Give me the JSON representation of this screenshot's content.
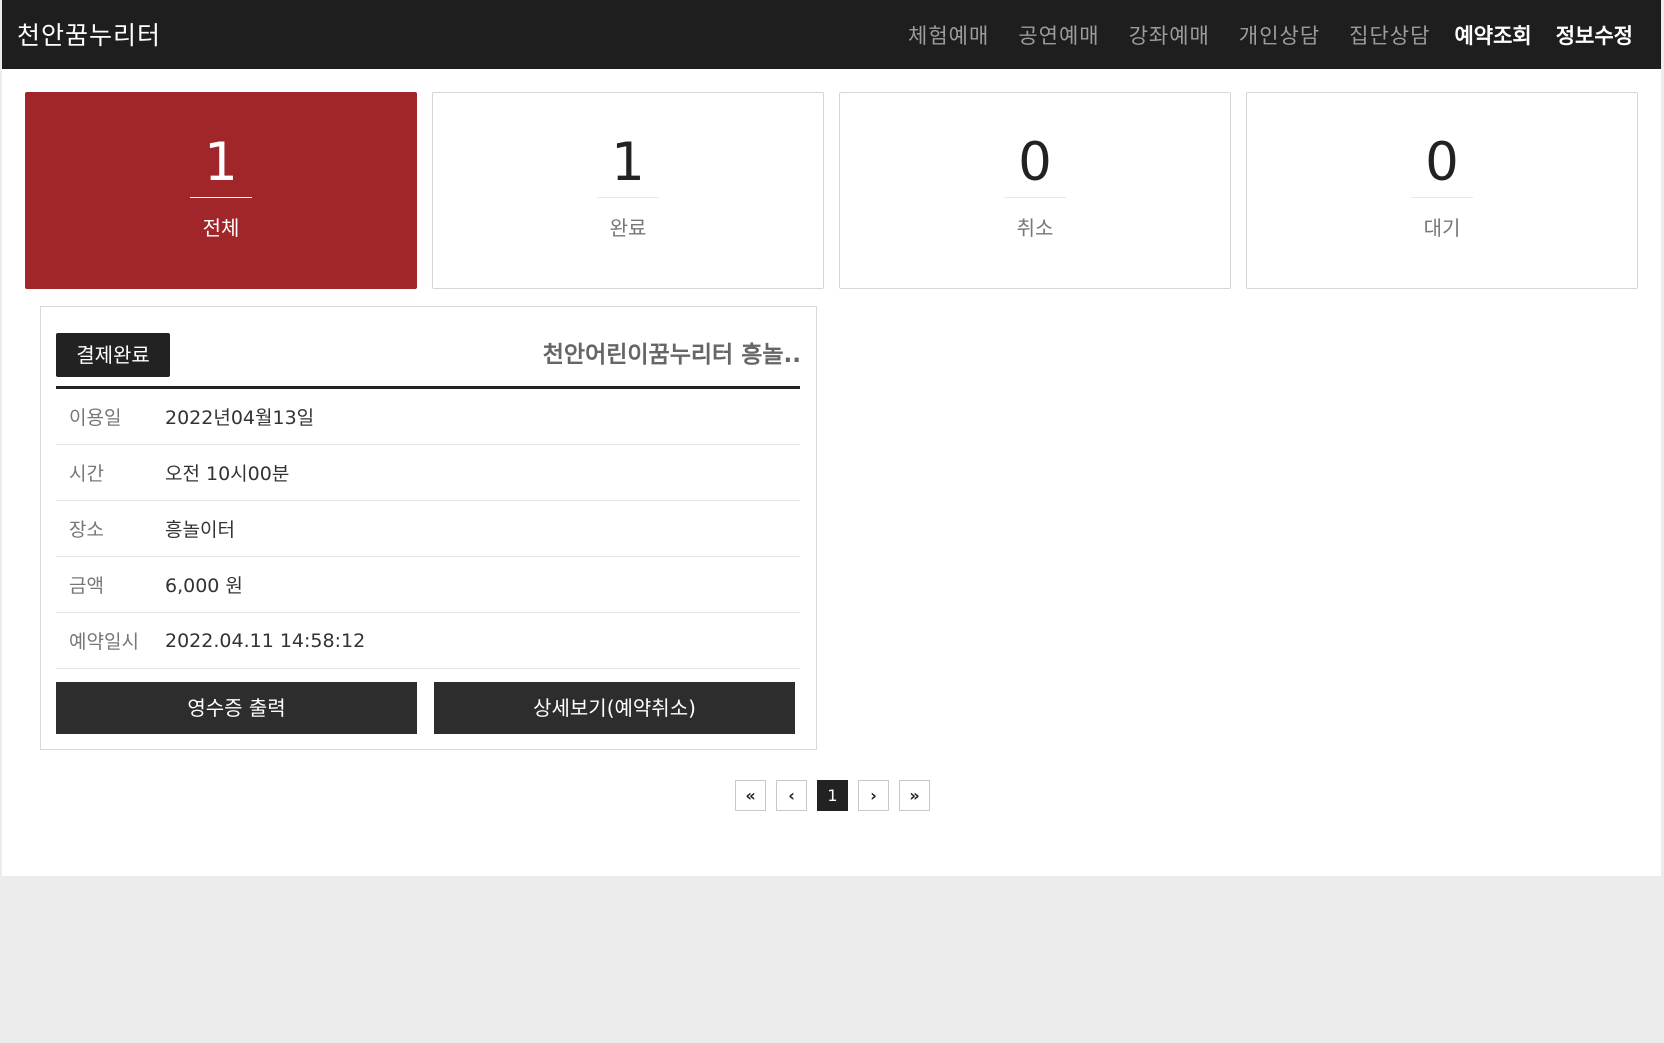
{
  "header": {
    "brand": "천안꿈누리터",
    "menu": [
      "체험예매",
      "공연예매",
      "강좌예매",
      "개인상담",
      "집단상담"
    ],
    "active_menu": [
      "예약조회",
      "정보수정"
    ]
  },
  "stats": [
    {
      "count": "1",
      "label": "전체"
    },
    {
      "count": "1",
      "label": "완료"
    },
    {
      "count": "0",
      "label": "취소"
    },
    {
      "count": "0",
      "label": "대기"
    }
  ],
  "reservation": {
    "status": "결제완료",
    "title": "천안어린이꿈누리터 흥놀..",
    "rows": [
      {
        "label": "이용일",
        "value": "2022년04월13일"
      },
      {
        "label": "시간",
        "value": "오전 10시00분"
      },
      {
        "label": "장소",
        "value": "흥놀이터"
      },
      {
        "label": "금액",
        "value": "6,000 원"
      },
      {
        "label": "예약일시",
        "value": "2022.04.11 14:58:12"
      }
    ],
    "receipt_button": "영수증 출력",
    "detail_button": "상세보기(예약취소)"
  },
  "pagination": {
    "first": "«",
    "prev": "‹",
    "current": "1",
    "next": "›",
    "last": "»"
  }
}
